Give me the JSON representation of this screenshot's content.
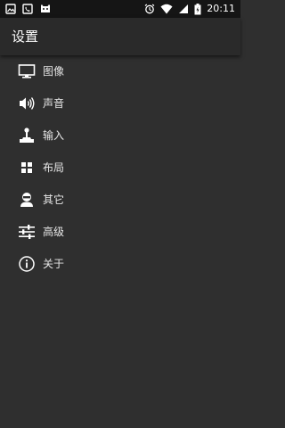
{
  "status_bar": {
    "time": "20:11",
    "left_icons": [
      "image-notification-icon",
      "phone-notification-icon",
      "game-notification-icon"
    ],
    "right_icons": [
      "alarm-icon",
      "wifi-icon",
      "signal-icon",
      "battery-icon"
    ]
  },
  "app_bar": {
    "title": "设置"
  },
  "menu": {
    "items": [
      {
        "label": "图像",
        "icon": "monitor-icon"
      },
      {
        "label": "声音",
        "icon": "speaker-icon"
      },
      {
        "label": "输入",
        "icon": "joystick-icon"
      },
      {
        "label": "布局",
        "icon": "grid-icon"
      },
      {
        "label": "其它",
        "icon": "robot-icon"
      },
      {
        "label": "高级",
        "icon": "sliders-icon"
      },
      {
        "label": "关于",
        "icon": "info-icon"
      }
    ]
  },
  "colors": {
    "background": "#2f2f2f",
    "app_bar": "#2a2a2a",
    "status_bar": "#151515",
    "text": "#ffffff"
  }
}
